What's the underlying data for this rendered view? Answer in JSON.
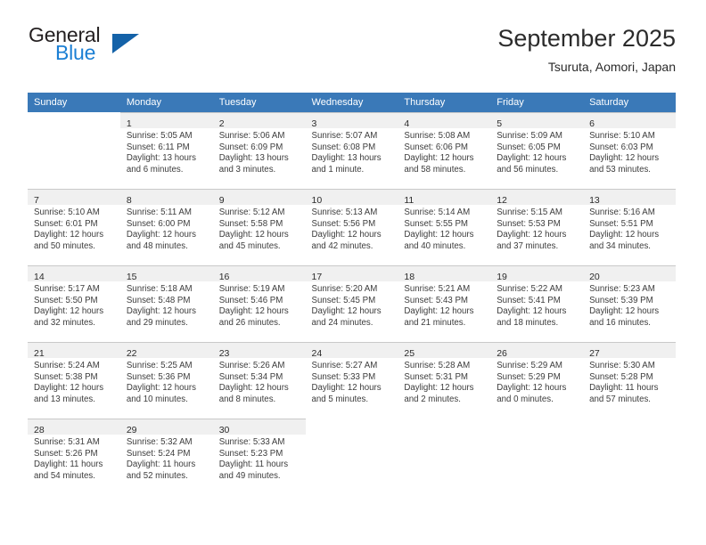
{
  "brand": {
    "name_top": "General",
    "name_bottom": "Blue",
    "triangle_color": "#1462a8",
    "blue_color": "#1b7fd4"
  },
  "header": {
    "title": "September 2025",
    "location": "Tsuruta, Aomori, Japan"
  },
  "theme": {
    "header_row_bg": "#3a79b8",
    "day_number_bg": "#f0f0f0",
    "grid_line": "#c9c9c9",
    "text": "#2b2b2b"
  },
  "weekday_headers": [
    "Sunday",
    "Monday",
    "Tuesday",
    "Wednesday",
    "Thursday",
    "Friday",
    "Saturday"
  ],
  "weeks": [
    [
      {
        "day": "",
        "sunrise": "",
        "sunset": "",
        "daylight_line1": "",
        "daylight_line2": ""
      },
      {
        "day": "1",
        "sunrise": "Sunrise: 5:05 AM",
        "sunset": "Sunset: 6:11 PM",
        "daylight_line1": "Daylight: 13 hours",
        "daylight_line2": "and 6 minutes."
      },
      {
        "day": "2",
        "sunrise": "Sunrise: 5:06 AM",
        "sunset": "Sunset: 6:09 PM",
        "daylight_line1": "Daylight: 13 hours",
        "daylight_line2": "and 3 minutes."
      },
      {
        "day": "3",
        "sunrise": "Sunrise: 5:07 AM",
        "sunset": "Sunset: 6:08 PM",
        "daylight_line1": "Daylight: 13 hours",
        "daylight_line2": "and 1 minute."
      },
      {
        "day": "4",
        "sunrise": "Sunrise: 5:08 AM",
        "sunset": "Sunset: 6:06 PM",
        "daylight_line1": "Daylight: 12 hours",
        "daylight_line2": "and 58 minutes."
      },
      {
        "day": "5",
        "sunrise": "Sunrise: 5:09 AM",
        "sunset": "Sunset: 6:05 PM",
        "daylight_line1": "Daylight: 12 hours",
        "daylight_line2": "and 56 minutes."
      },
      {
        "day": "6",
        "sunrise": "Sunrise: 5:10 AM",
        "sunset": "Sunset: 6:03 PM",
        "daylight_line1": "Daylight: 12 hours",
        "daylight_line2": "and 53 minutes."
      }
    ],
    [
      {
        "day": "7",
        "sunrise": "Sunrise: 5:10 AM",
        "sunset": "Sunset: 6:01 PM",
        "daylight_line1": "Daylight: 12 hours",
        "daylight_line2": "and 50 minutes."
      },
      {
        "day": "8",
        "sunrise": "Sunrise: 5:11 AM",
        "sunset": "Sunset: 6:00 PM",
        "daylight_line1": "Daylight: 12 hours",
        "daylight_line2": "and 48 minutes."
      },
      {
        "day": "9",
        "sunrise": "Sunrise: 5:12 AM",
        "sunset": "Sunset: 5:58 PM",
        "daylight_line1": "Daylight: 12 hours",
        "daylight_line2": "and 45 minutes."
      },
      {
        "day": "10",
        "sunrise": "Sunrise: 5:13 AM",
        "sunset": "Sunset: 5:56 PM",
        "daylight_line1": "Daylight: 12 hours",
        "daylight_line2": "and 42 minutes."
      },
      {
        "day": "11",
        "sunrise": "Sunrise: 5:14 AM",
        "sunset": "Sunset: 5:55 PM",
        "daylight_line1": "Daylight: 12 hours",
        "daylight_line2": "and 40 minutes."
      },
      {
        "day": "12",
        "sunrise": "Sunrise: 5:15 AM",
        "sunset": "Sunset: 5:53 PM",
        "daylight_line1": "Daylight: 12 hours",
        "daylight_line2": "and 37 minutes."
      },
      {
        "day": "13",
        "sunrise": "Sunrise: 5:16 AM",
        "sunset": "Sunset: 5:51 PM",
        "daylight_line1": "Daylight: 12 hours",
        "daylight_line2": "and 34 minutes."
      }
    ],
    [
      {
        "day": "14",
        "sunrise": "Sunrise: 5:17 AM",
        "sunset": "Sunset: 5:50 PM",
        "daylight_line1": "Daylight: 12 hours",
        "daylight_line2": "and 32 minutes."
      },
      {
        "day": "15",
        "sunrise": "Sunrise: 5:18 AM",
        "sunset": "Sunset: 5:48 PM",
        "daylight_line1": "Daylight: 12 hours",
        "daylight_line2": "and 29 minutes."
      },
      {
        "day": "16",
        "sunrise": "Sunrise: 5:19 AM",
        "sunset": "Sunset: 5:46 PM",
        "daylight_line1": "Daylight: 12 hours",
        "daylight_line2": "and 26 minutes."
      },
      {
        "day": "17",
        "sunrise": "Sunrise: 5:20 AM",
        "sunset": "Sunset: 5:45 PM",
        "daylight_line1": "Daylight: 12 hours",
        "daylight_line2": "and 24 minutes."
      },
      {
        "day": "18",
        "sunrise": "Sunrise: 5:21 AM",
        "sunset": "Sunset: 5:43 PM",
        "daylight_line1": "Daylight: 12 hours",
        "daylight_line2": "and 21 minutes."
      },
      {
        "day": "19",
        "sunrise": "Sunrise: 5:22 AM",
        "sunset": "Sunset: 5:41 PM",
        "daylight_line1": "Daylight: 12 hours",
        "daylight_line2": "and 18 minutes."
      },
      {
        "day": "20",
        "sunrise": "Sunrise: 5:23 AM",
        "sunset": "Sunset: 5:39 PM",
        "daylight_line1": "Daylight: 12 hours",
        "daylight_line2": "and 16 minutes."
      }
    ],
    [
      {
        "day": "21",
        "sunrise": "Sunrise: 5:24 AM",
        "sunset": "Sunset: 5:38 PM",
        "daylight_line1": "Daylight: 12 hours",
        "daylight_line2": "and 13 minutes."
      },
      {
        "day": "22",
        "sunrise": "Sunrise: 5:25 AM",
        "sunset": "Sunset: 5:36 PM",
        "daylight_line1": "Daylight: 12 hours",
        "daylight_line2": "and 10 minutes."
      },
      {
        "day": "23",
        "sunrise": "Sunrise: 5:26 AM",
        "sunset": "Sunset: 5:34 PM",
        "daylight_line1": "Daylight: 12 hours",
        "daylight_line2": "and 8 minutes."
      },
      {
        "day": "24",
        "sunrise": "Sunrise: 5:27 AM",
        "sunset": "Sunset: 5:33 PM",
        "daylight_line1": "Daylight: 12 hours",
        "daylight_line2": "and 5 minutes."
      },
      {
        "day": "25",
        "sunrise": "Sunrise: 5:28 AM",
        "sunset": "Sunset: 5:31 PM",
        "daylight_line1": "Daylight: 12 hours",
        "daylight_line2": "and 2 minutes."
      },
      {
        "day": "26",
        "sunrise": "Sunrise: 5:29 AM",
        "sunset": "Sunset: 5:29 PM",
        "daylight_line1": "Daylight: 12 hours",
        "daylight_line2": "and 0 minutes."
      },
      {
        "day": "27",
        "sunrise": "Sunrise: 5:30 AM",
        "sunset": "Sunset: 5:28 PM",
        "daylight_line1": "Daylight: 11 hours",
        "daylight_line2": "and 57 minutes."
      }
    ],
    [
      {
        "day": "28",
        "sunrise": "Sunrise: 5:31 AM",
        "sunset": "Sunset: 5:26 PM",
        "daylight_line1": "Daylight: 11 hours",
        "daylight_line2": "and 54 minutes."
      },
      {
        "day": "29",
        "sunrise": "Sunrise: 5:32 AM",
        "sunset": "Sunset: 5:24 PM",
        "daylight_line1": "Daylight: 11 hours",
        "daylight_line2": "and 52 minutes."
      },
      {
        "day": "30",
        "sunrise": "Sunrise: 5:33 AM",
        "sunset": "Sunset: 5:23 PM",
        "daylight_line1": "Daylight: 11 hours",
        "daylight_line2": "and 49 minutes."
      },
      {
        "day": "",
        "sunrise": "",
        "sunset": "",
        "daylight_line1": "",
        "daylight_line2": ""
      },
      {
        "day": "",
        "sunrise": "",
        "sunset": "",
        "daylight_line1": "",
        "daylight_line2": ""
      },
      {
        "day": "",
        "sunrise": "",
        "sunset": "",
        "daylight_line1": "",
        "daylight_line2": ""
      },
      {
        "day": "",
        "sunrise": "",
        "sunset": "",
        "daylight_line1": "",
        "daylight_line2": ""
      }
    ]
  ]
}
